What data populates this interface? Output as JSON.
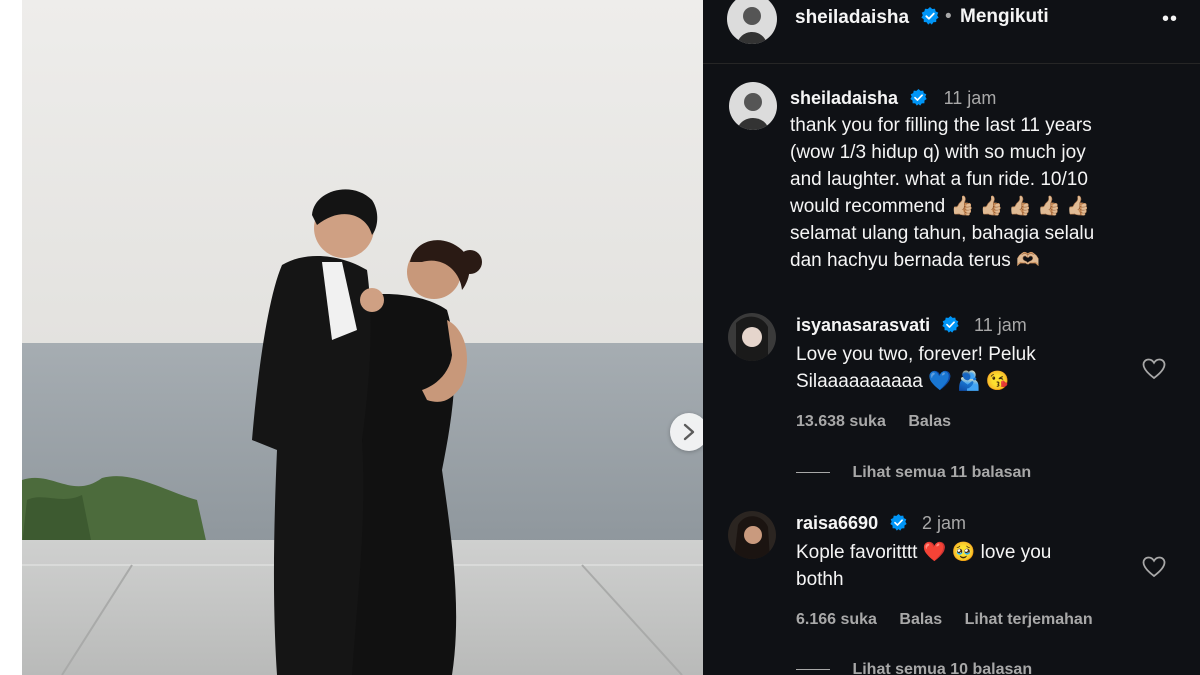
{
  "post": {
    "author": "sheiladaisha",
    "follow_status": "Mengikuti",
    "separator": "•",
    "more": "••",
    "caption": {
      "username": "sheiladaisha",
      "time": "11 jam",
      "lines": [
        "thank you for filling the last 11 years",
        "(wow 1/3 hidup q) with so much joy",
        "and laughter. what a fun ride. 10/10",
        "would recommend 👍🏼 👍🏼 👍🏼 👍🏼 👍🏼",
        "selamat ulang tahun, bahagia selalu",
        "dan hachyu bernada terus 🫶🏼"
      ]
    }
  },
  "comments": [
    {
      "username": "isyanasarasvati",
      "time": "11 jam",
      "text_lines": [
        "Love you two, forever! Peluk",
        "Silaaaaaaaaaa 💙 🫂 😘"
      ],
      "likes": "13.638 suka",
      "reply": "Balas",
      "translate": "",
      "view_replies": "Lihat semua 11 balasan"
    },
    {
      "username": "raisa6690",
      "time": "2 jam",
      "text_lines": [
        "Kople favoritttt ❤️ 🥹 love you",
        "bothh"
      ],
      "likes": "6.166 suka",
      "reply": "Balas",
      "translate": "Lihat terjemahan",
      "view_replies": "Lihat semua 10 balasan"
    }
  ],
  "colors": {
    "panel_bg": "#0f1115",
    "text": "#f5f5f5",
    "muted": "#a8a8a8",
    "verified": "#0095f6"
  },
  "icons": {
    "verified": "verified-badge-icon",
    "like": "heart-icon",
    "next": "chevron-right-icon",
    "more": "more-options-icon"
  }
}
